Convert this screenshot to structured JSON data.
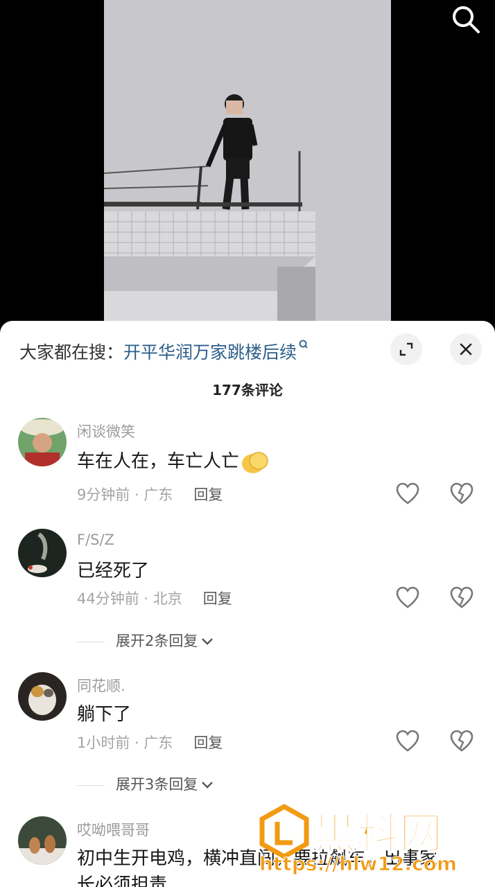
{
  "search_icon": "search-icon",
  "sheet": {
    "search_prefix": "大家都在搜：",
    "search_query": "开平华润万家跳楼后续",
    "comment_count": "177条评论"
  },
  "comments": [
    {
      "username": "闲谈微笑",
      "text": "车在人在，车亡人亡",
      "time": "9分钟前",
      "location": "广东",
      "reply_label": "回复"
    },
    {
      "username": "F/S/Z",
      "text": "已经死了",
      "time": "44分钟前",
      "location": "北京",
      "reply_label": "回复",
      "expand_label": "展开2条回复"
    },
    {
      "username": "同花顺.",
      "text": "躺下了",
      "time": "1小时前",
      "location": "广东",
      "reply_label": "回复",
      "expand_label": "展开3条回复"
    },
    {
      "username": "哎呦喂哥哥",
      "text": "初中生开电鸡，横冲直闯，要拉飙车，出事家",
      "text_line2": "长必须担责"
    }
  ],
  "watermark": {
    "brand": "黑料网",
    "url": "https://hlw12.com"
  },
  "colors": {
    "query_link": "#2c5d8a",
    "watermark_orange": "#f29a12"
  }
}
